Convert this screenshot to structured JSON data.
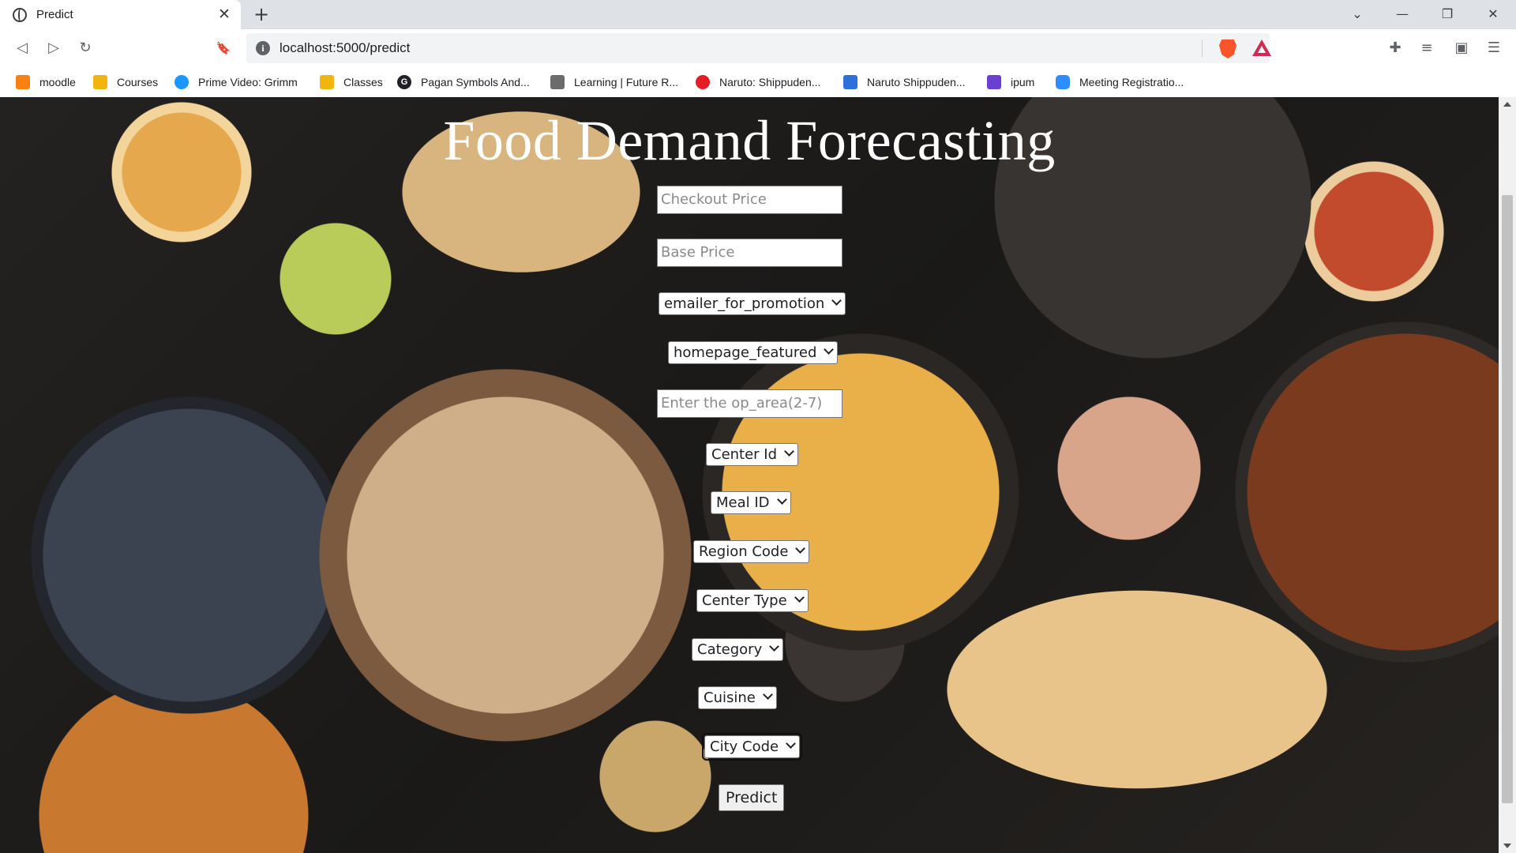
{
  "browser": {
    "tab_title": "Predict",
    "tab_close": "✕",
    "new_tab": "+",
    "url": "localhost:5000/predict",
    "window_controls": {
      "tab_search": "⌄",
      "minimize": "—",
      "restore": "❐",
      "close": "✕"
    },
    "nav": {
      "back": "◁",
      "forward": "▷",
      "reload": "↻",
      "bookmark": "🔖"
    },
    "toolbar_right": {
      "extensions": "✚",
      "reading_list": "≡",
      "wallet": "▣",
      "menu": "☰"
    }
  },
  "bookmarks": [
    {
      "label": "moodle",
      "icon": "moodle-icon",
      "color": "#f98012"
    },
    {
      "label": "Courses",
      "icon": "classroom-icon",
      "color": "#f2b40f"
    },
    {
      "label": "Prime Video: Grimm",
      "icon": "prime-video-icon",
      "color": "#1a98ff"
    },
    {
      "label": "Classes",
      "icon": "classroom-icon",
      "color": "#f2b40f"
    },
    {
      "label": "Pagan Symbols And...",
      "icon": "g-icon",
      "color": "#202124"
    },
    {
      "label": "Learning | Future R...",
      "icon": "learning-icon",
      "color": "#6b6b6b"
    },
    {
      "label": "Naruto: Shippuden...",
      "icon": "crunchyroll-icon",
      "color": "#e31e24"
    },
    {
      "label": "Naruto Shippuden...",
      "icon": "arrow-icon",
      "color": "#2f6fdb"
    },
    {
      "label": "ipum",
      "icon": "list-icon",
      "color": "#6a3fd1"
    },
    {
      "label": "Meeting Registratio...",
      "icon": "zoom-icon",
      "color": "#2d8cff"
    }
  ],
  "page": {
    "title": "Food Demand Forecasting",
    "fields": {
      "checkout_price": "Checkout Price",
      "base_price": "Base Price",
      "emailer": "emailer_for_promotion",
      "homepage": "homepage_featured",
      "op_area": "Enter the op_area(2-7)",
      "center_id": "Center Id",
      "meal_id": "Meal ID",
      "region_code": "Region Code",
      "center_type": "Center Type",
      "category": "Category",
      "cuisine": "Cuisine",
      "city_code": "City Code"
    },
    "submit_label": "Predict"
  }
}
